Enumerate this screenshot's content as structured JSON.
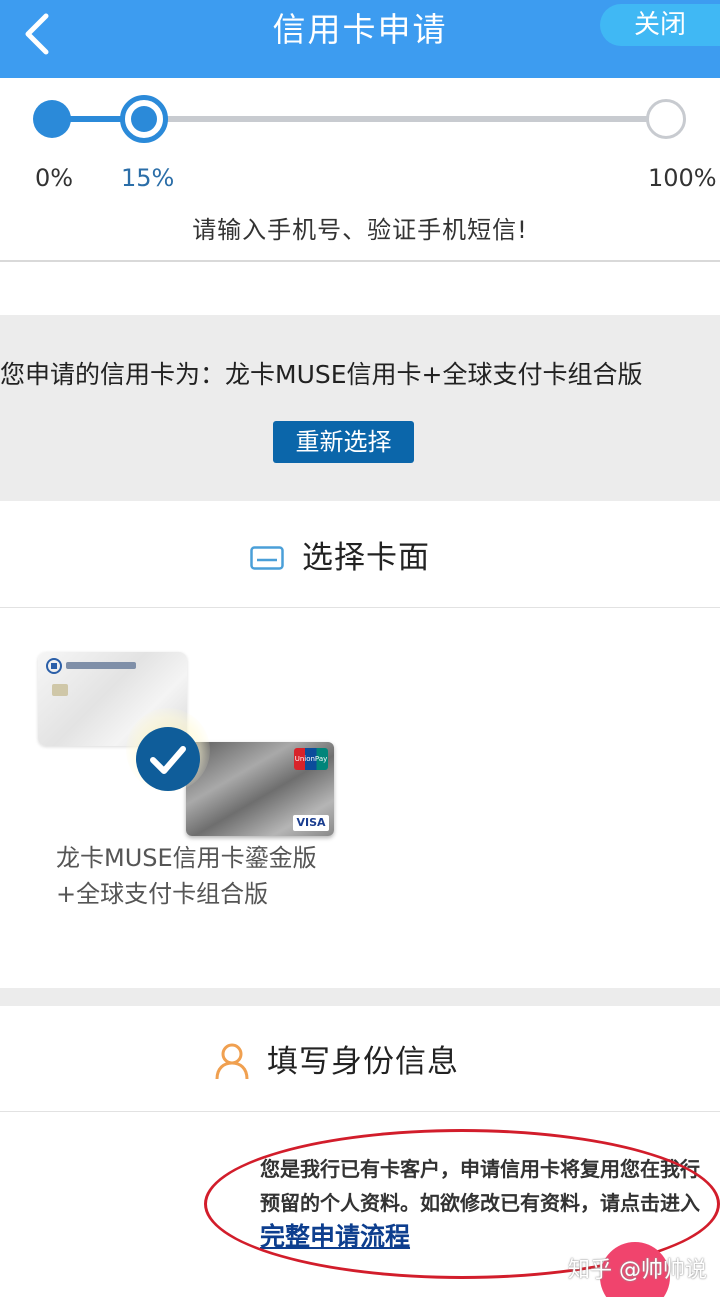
{
  "header": {
    "title": "信用卡申请",
    "close_label": "关闭"
  },
  "progress": {
    "value_percent": 15,
    "start_label": "0%",
    "current_label": "15%",
    "end_label": "100%",
    "hint": "请输入手机号、验证手机短信!"
  },
  "selected_card": {
    "text": "您申请的信用卡为：龙卡MUSE信用卡+全球支付卡组合版",
    "reselect_label": "重新选择"
  },
  "card_face_section": {
    "title": "选择卡面",
    "card_name": "龙卡MUSE信用卡鎏金版+全球支付卡组合版",
    "unionpay_text": "UnionPay",
    "visa_text": "VISA"
  },
  "identity_section": {
    "title": "填写身份信息",
    "notice_text": "您是我行已有卡客户，申请信用卡将复用您在我行预留的个人资料。如欲修改已有资料，请点击进入 ",
    "notice_link": "完整申请流程"
  },
  "watermark": "知乎 @帅帅说",
  "colors": {
    "header_bg": "#3d9cf0",
    "progress_blue": "#2b8ad9",
    "button_blue": "#0b66aa",
    "annotation_red": "#d21d2b"
  }
}
